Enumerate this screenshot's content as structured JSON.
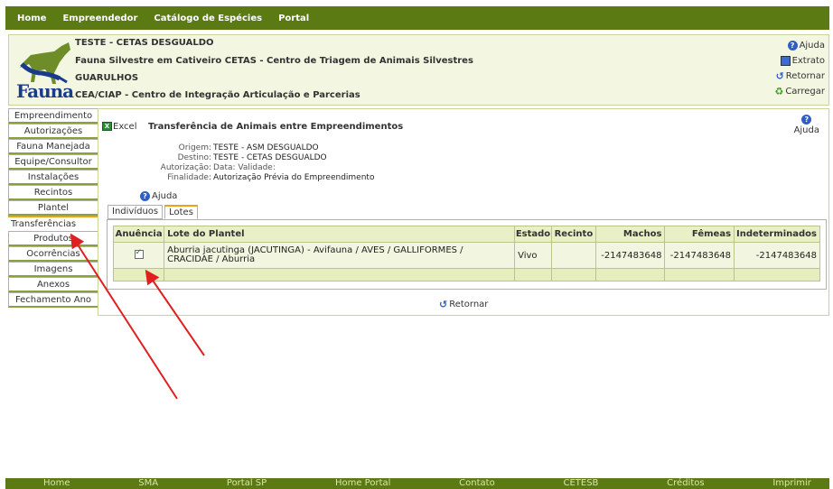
{
  "topnav": {
    "items": [
      "Home",
      "Empreendedor",
      "Catálogo de Espécies",
      "Portal"
    ]
  },
  "header": {
    "logo_text": "Fauna",
    "lines": [
      "TESTE - CETAS DESGUALDO",
      "Fauna Silvestre em Cativeiro CETAS - Centro de Triagem de Animais Silvestres",
      "GUARULHOS",
      "CEA/CIAP - Centro de Integração Articulação e Parcerias"
    ],
    "links": {
      "ajuda": "Ajuda",
      "extrato": "Extrato",
      "retornar": "Retornar",
      "carregar": "Carregar"
    }
  },
  "menu": {
    "items": [
      "Empreendimento",
      "Autorizações",
      "Fauna Manejada",
      "Equipe/Consultor",
      "Instalações",
      "Recintos",
      "Plantel",
      "Transferências",
      "Produtos",
      "Ocorrências",
      "Imagens",
      "Anexos",
      "Fechamento Ano"
    ],
    "active_index": 7
  },
  "main": {
    "excel_label": "Excel",
    "title": "Transferência de Animais entre Empreendimentos",
    "help_label": "Ajuda",
    "info": {
      "origem_key": "Origem:",
      "origem_val": "TESTE - ASM DESGUALDO",
      "destino_key": "Destino:",
      "destino_val": "TESTE - CETAS DESGUALDO",
      "autorizacao_key": "Autorização:",
      "autorizacao_val": "Data:  Validade:",
      "finalidade_key": "Finalidade:",
      "finalidade_val": "Autorização Prévia do Empreendimento"
    },
    "ajuda2": "Ajuda",
    "tabs": [
      "Indivíduos",
      "Lotes"
    ],
    "active_tab": 1,
    "table": {
      "headers": [
        "Anuência",
        "Lote do Plantel",
        "Estado",
        "Recinto",
        "Machos",
        "Fêmeas",
        "Indeterminados"
      ],
      "rows": [
        {
          "anuencia_checked": true,
          "lote": "Aburria jacutinga (JACUTINGA) - Avifauna / AVES / GALLIFORMES / CRACIDAE / Aburria",
          "estado": "Vivo",
          "recinto": "",
          "machos": "-2147483648",
          "femeas": "-2147483648",
          "indeterminados": "-2147483648"
        }
      ]
    },
    "retornar": "Retornar"
  },
  "footer": {
    "items": [
      "Home",
      "SMA",
      "Portal SP",
      "Home Portal",
      "Contato",
      "CETESB",
      "Créditos",
      "Imprimir"
    ]
  },
  "colors": {
    "nav_green": "#5c7a14",
    "header_bg": "#f3f6e1",
    "arrow_red": "#e02020"
  }
}
